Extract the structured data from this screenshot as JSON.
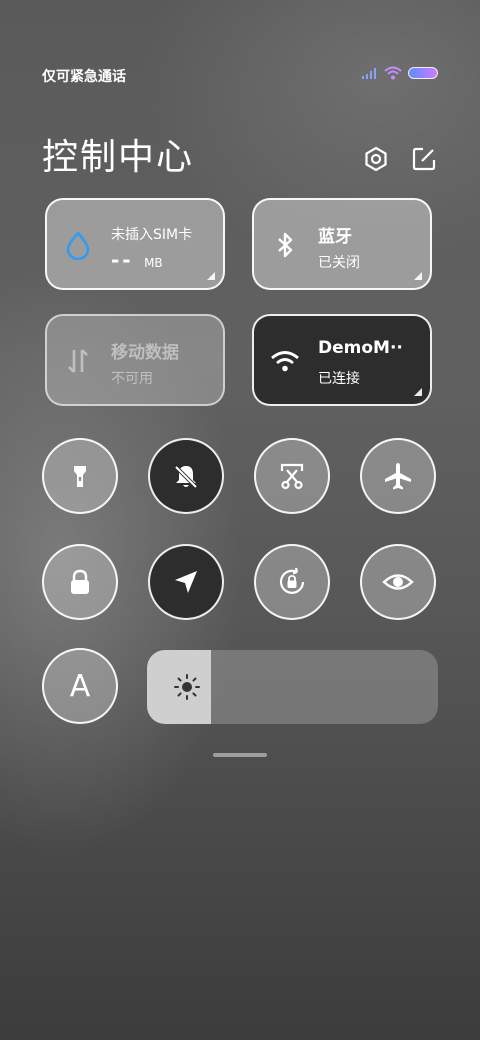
{
  "status_bar": {
    "carrier_text": "仅可紧急通话",
    "signal_icon": "signal-bars-icon",
    "wifi_icon": "wifi-icon",
    "battery_icon": "battery-icon"
  },
  "header": {
    "title": "控制中心",
    "settings_icon": "gear-icon",
    "edit_icon": "edit-icon"
  },
  "tiles": {
    "data_usage": {
      "line1": "未插入SIM卡",
      "value": "--",
      "unit": "MB",
      "icon": "water-drop-icon"
    },
    "bluetooth": {
      "label": "蓝牙",
      "status": "已关闭",
      "icon": "bluetooth-icon"
    },
    "mobile_data": {
      "label": "移动数据",
      "status": "不可用",
      "icon": "data-arrows-icon"
    },
    "wifi": {
      "label": "DemoM··",
      "status": "已连接",
      "icon": "wifi-icon"
    }
  },
  "toggles": [
    {
      "name": "flashlight",
      "icon": "flashlight-icon",
      "active": false
    },
    {
      "name": "mute",
      "icon": "bell-off-icon",
      "active": true
    },
    {
      "name": "screenshot",
      "icon": "scissors-icon",
      "active": false
    },
    {
      "name": "airplane",
      "icon": "airplane-icon",
      "active": false
    },
    {
      "name": "lock",
      "icon": "lock-icon",
      "active": false
    },
    {
      "name": "location",
      "icon": "location-arrow-icon",
      "active": true
    },
    {
      "name": "rotation",
      "icon": "rotation-lock-icon",
      "active": false
    },
    {
      "name": "eye-care",
      "icon": "eye-icon",
      "active": false
    }
  ],
  "auto_brightness": {
    "label": "A"
  },
  "brightness": {
    "level": 0.22,
    "icon": "sun-icon"
  },
  "colors": {
    "accent_blue": "#2f9bf3",
    "dark_tile": "#2d2d2d"
  }
}
